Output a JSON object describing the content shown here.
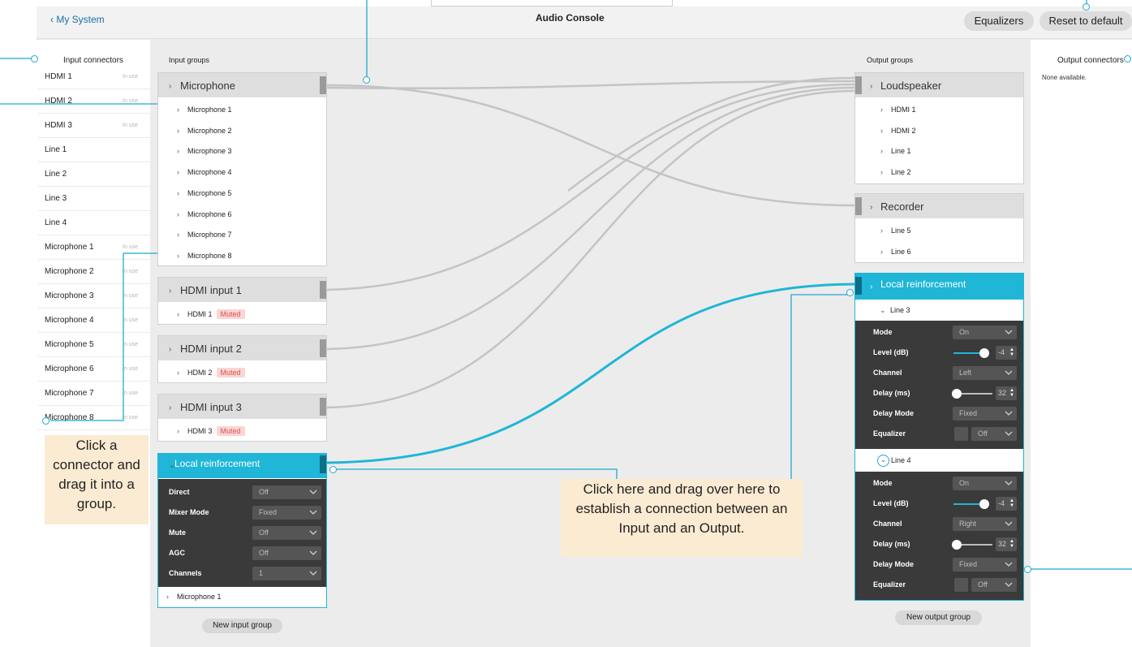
{
  "header": {
    "back_label": "My System",
    "title": "Audio Console",
    "equalizers_label": "Equalizers",
    "reset_label": "Reset to default"
  },
  "input_connectors": {
    "heading": "Input connectors",
    "items": [
      {
        "label": "HDMI 1",
        "status": "In use"
      },
      {
        "label": "HDMI 2",
        "status": "In use"
      },
      {
        "label": "HDMI 3",
        "status": "In use"
      },
      {
        "label": "Line 1",
        "status": ""
      },
      {
        "label": "Line 2",
        "status": ""
      },
      {
        "label": "Line 3",
        "status": ""
      },
      {
        "label": "Line 4",
        "status": ""
      },
      {
        "label": "Microphone 1",
        "status": "In use"
      },
      {
        "label": "Microphone 2",
        "status": "In use"
      },
      {
        "label": "Microphone 3",
        "status": "In use"
      },
      {
        "label": "Microphone 4",
        "status": "In use"
      },
      {
        "label": "Microphone 5",
        "status": "In use"
      },
      {
        "label": "Microphone 6",
        "status": "In use"
      },
      {
        "label": "Microphone 7",
        "status": "In use"
      },
      {
        "label": "Microphone 8",
        "status": "In use"
      }
    ]
  },
  "output_connectors": {
    "heading": "Output connectors",
    "empty_text": "None available."
  },
  "input_groups": {
    "heading": "Input groups",
    "microphone": {
      "title": "Microphone",
      "items": [
        "Microphone 1",
        "Microphone 2",
        "Microphone 3",
        "Microphone 4",
        "Microphone 5",
        "Microphone 6",
        "Microphone 7",
        "Microphone 8"
      ]
    },
    "hdmi1": {
      "title": "HDMI input 1",
      "item": "HDMI 1",
      "badge": "Muted"
    },
    "hdmi2": {
      "title": "HDMI input 2",
      "item": "HDMI 2",
      "badge": "Muted"
    },
    "hdmi3": {
      "title": "HDMI input 3",
      "item": "HDMI 3",
      "badge": "Muted"
    },
    "local": {
      "title": "Local reinforcement",
      "settings": [
        {
          "label": "Direct",
          "value": "Off"
        },
        {
          "label": "Mixer Mode",
          "value": "Fixed"
        },
        {
          "label": "Mute",
          "value": "Off"
        },
        {
          "label": "AGC",
          "value": "Off"
        },
        {
          "label": "Channels",
          "value": "1"
        }
      ],
      "item": "Microphone 1"
    },
    "new_label": "New input group"
  },
  "output_groups": {
    "heading": "Output groups",
    "loudspeaker": {
      "title": "Loudspeaker",
      "items": [
        "HDMI 1",
        "HDMI 2",
        "Line 1",
        "Line 2"
      ]
    },
    "recorder": {
      "title": "Recorder",
      "items": [
        "Line 5",
        "Line 6"
      ]
    },
    "local": {
      "title": "Local reinforcement",
      "line3": {
        "label": "Line 3",
        "mode_label": "Mode",
        "mode": "On",
        "level_label": "Level (dB)",
        "level": "-4",
        "channel_label": "Channel",
        "channel": "Left",
        "delay_label": "Delay (ms)",
        "delay": "32",
        "delay_mode_label": "Delay Mode",
        "delay_mode": "Fixed",
        "eq_label": "Equalizer",
        "eq": "Off"
      },
      "line4": {
        "label": "Line 4",
        "mode_label": "Mode",
        "mode": "On",
        "level_label": "Level (dB)",
        "level": "-4",
        "channel_label": "Channel",
        "channel": "Right",
        "delay_label": "Delay (ms)",
        "delay": "32",
        "delay_mode_label": "Delay Mode",
        "delay_mode": "Fixed",
        "eq_label": "Equalizer",
        "eq": "Off"
      }
    },
    "new_label": "New output group"
  },
  "callouts": {
    "connector": "Click a connector and drag it into a group.",
    "connection": "Click here and drag over here to establish a connection between an Input and an Output."
  },
  "colors": {
    "accent": "#1fb6d7",
    "annotation": "#1fa9cf",
    "callout_bg": "#fcebd3",
    "muted_bg": "#fbd5d5",
    "muted_text": "#d9534f",
    "link": "#1a6fa8"
  }
}
